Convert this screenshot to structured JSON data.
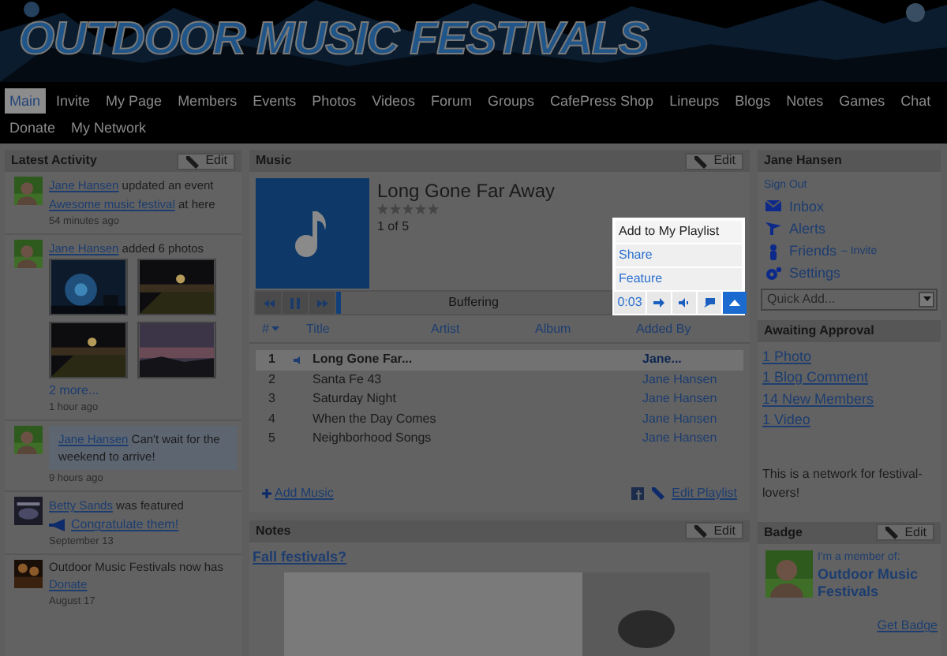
{
  "site_title": "OUTDOOR MUSIC FESTIVALS",
  "nav": [
    {
      "label": "Main",
      "selected": true
    },
    {
      "label": "Invite",
      "selected": false
    },
    {
      "label": "My Page",
      "selected": false
    },
    {
      "label": "Members",
      "selected": false
    },
    {
      "label": "Events",
      "selected": false
    },
    {
      "label": "Photos",
      "selected": false
    },
    {
      "label": "Videos",
      "selected": false
    },
    {
      "label": "Forum",
      "selected": false
    },
    {
      "label": "Groups",
      "selected": false
    },
    {
      "label": "CafePress Shop",
      "selected": false
    },
    {
      "label": "Lineups",
      "selected": false
    },
    {
      "label": "Blogs",
      "selected": false
    },
    {
      "label": "Notes",
      "selected": false
    },
    {
      "label": "Games",
      "selected": false
    },
    {
      "label": "Chat",
      "selected": false
    },
    {
      "label": "Donate",
      "selected": false
    },
    {
      "label": "My Network",
      "selected": false
    }
  ],
  "latest_activity": {
    "title": "Latest Activity",
    "edit": "Edit",
    "items": [
      {
        "kind": "event",
        "user": "Jane Hansen",
        "text": "updated an event",
        "link": "Awesome music festival",
        "after": "at here",
        "time": "54 minutes ago"
      },
      {
        "kind": "photos",
        "user": "Jane Hansen",
        "text": "added 6 photos",
        "more": "2 more...",
        "time": "1 hour ago"
      },
      {
        "kind": "status",
        "user": "Jane Hansen",
        "text": "Can't wait for the weekend to arrive!",
        "time": "9 hours ago"
      },
      {
        "kind": "featured",
        "user": "Betty Sands",
        "text": "was featured",
        "link": "Congratulate them!",
        "time": "September 13"
      },
      {
        "kind": "donate",
        "text": "Outdoor Music Festivals now has",
        "link": "Donate",
        "time": "August 17"
      }
    ]
  },
  "music": {
    "title": "Music",
    "edit": "Edit",
    "track": "Long Gone Far Away",
    "stars": 0,
    "position": "1 of 5",
    "menu": [
      {
        "label": "Add to My Playlist",
        "selected": true
      },
      {
        "label": "Share",
        "selected": false
      },
      {
        "label": "Feature",
        "selected": false
      }
    ],
    "player": {
      "status": "Buffering",
      "level": 0.02,
      "time": "0:03"
    },
    "columns": [
      "#",
      "Title",
      "Artist",
      "Album",
      "Added By"
    ],
    "rows": [
      {
        "number": "1",
        "title": "Long Gone Far...",
        "added_by": "Jane...",
        "selected": true
      },
      {
        "number": "2",
        "title": "Santa Fe 43",
        "added_by": "Jane Hansen",
        "selected": false
      },
      {
        "number": "3",
        "title": "Saturday Night",
        "added_by": "Jane Hansen",
        "selected": false
      },
      {
        "number": "4",
        "title": "When the Day Comes",
        "added_by": "Jane Hansen",
        "selected": false
      },
      {
        "number": "5",
        "title": "Neighborhood Songs",
        "added_by": "Jane Hansen",
        "selected": false
      }
    ],
    "add_music": "Add Music",
    "edit_playlist": "Edit Playlist"
  },
  "notes": {
    "title": "Notes",
    "edit": "Edit",
    "note_title": "Fall festivals?"
  },
  "user_box": {
    "title": "Jane Hansen",
    "sign_out": "Sign Out",
    "links": [
      {
        "kind": "inbox",
        "label": "Inbox"
      },
      {
        "kind": "alerts",
        "label": "Alerts"
      },
      {
        "kind": "friends",
        "label": "Friends",
        "extra": "– Invite"
      },
      {
        "kind": "settings",
        "label": "Settings"
      }
    ],
    "quick_add": "Quick Add..."
  },
  "awaiting_approval": {
    "title": "Awaiting Approval",
    "links": [
      "1 Photo",
      "1 Blog Comment",
      "14 New Members",
      "1 Video"
    ]
  },
  "description": "This is a network for festival-lovers!",
  "badge": {
    "title": "Badge",
    "edit": "Edit",
    "caption": "I'm a member of:",
    "name": "Outdoor Music Festivals",
    "get_badge": "Get Badge"
  }
}
